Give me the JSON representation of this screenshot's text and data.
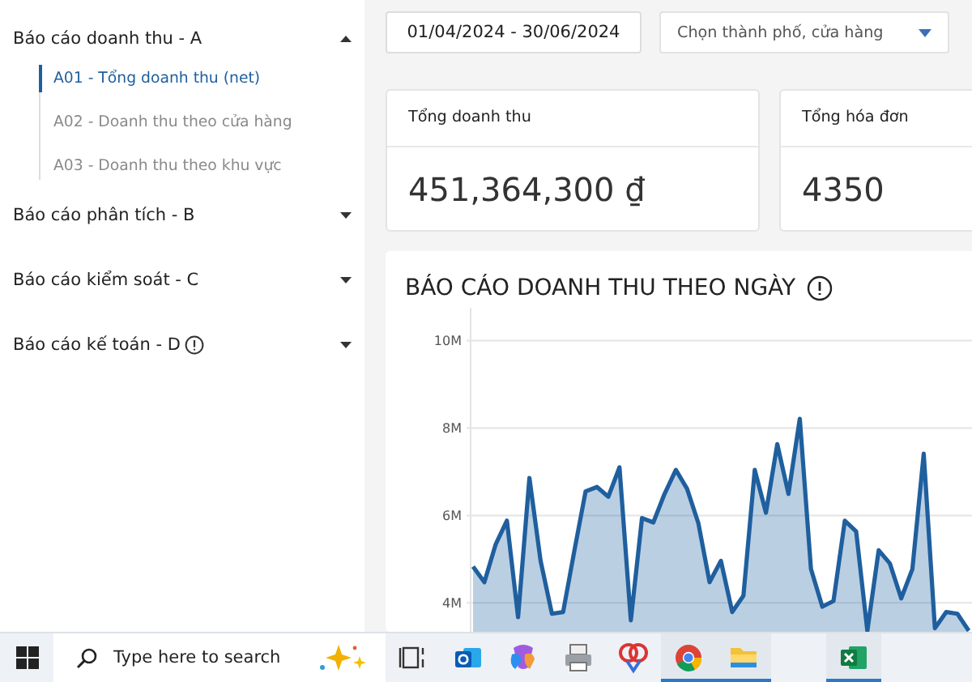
{
  "sidebar": {
    "groups": [
      {
        "label": "Báo cáo doanh thu - A",
        "expanded": true,
        "info": false,
        "items": [
          {
            "label": "A01 - Tổng doanh thu (net)",
            "selected": true
          },
          {
            "label": "A02 - Doanh thu theo cửa hàng",
            "selected": false
          },
          {
            "label": "A03 - Doanh thu theo khu vực",
            "selected": false
          }
        ]
      },
      {
        "label": "Báo cáo phân tích - B",
        "expanded": false,
        "info": false
      },
      {
        "label": "Báo cáo kiểm soát - C",
        "expanded": false,
        "info": false
      },
      {
        "label": "Báo cáo kế toán - D",
        "expanded": false,
        "info": true
      }
    ]
  },
  "filters": {
    "date_range": "01/04/2024 - 30/06/2024",
    "store_select": {
      "placeholder": "Chọn thành phố, cửa hàng"
    }
  },
  "stats": [
    {
      "label": "Tổng doanh thu",
      "value": "451,364,300 ₫"
    },
    {
      "label": "Tổng hóa đơn",
      "value": "4350"
    }
  ],
  "chart_card": {
    "title": "BÁO CÁO DOANH THU THEO NGÀY",
    "chart_data": {
      "type": "area",
      "grid": true,
      "ylim": [
        3.3,
        10.75
      ],
      "yticks": [
        {
          "value": 4,
          "label": "4M"
        },
        {
          "value": 6,
          "label": "6M"
        },
        {
          "value": 8,
          "label": "8M"
        },
        {
          "value": 10,
          "label": "10M"
        }
      ],
      "series": [
        {
          "color": "#1f5f9e",
          "values": [
            4.83,
            4.47,
            5.33,
            5.88,
            3.67,
            6.86,
            4.96,
            3.75,
            3.79,
            5.2,
            6.55,
            6.65,
            6.43,
            7.1,
            3.6,
            5.94,
            5.84,
            6.49,
            7.04,
            6.61,
            5.82,
            4.47,
            4.96,
            3.79,
            4.16,
            7.04,
            6.06,
            7.63,
            6.49,
            8.21,
            4.77,
            3.91,
            4.04,
            5.88,
            5.63,
            3.36,
            5.2,
            4.9,
            4.1,
            4.77,
            7.41,
            3.42,
            3.79,
            3.75,
            3.36
          ]
        }
      ]
    }
  },
  "taskbar": {
    "search": {
      "placeholder": "Type here to search"
    },
    "apps": [
      {
        "kind": "taskview",
        "running": false
      },
      {
        "kind": "outlook",
        "running": false
      },
      {
        "kind": "copilot",
        "running": false
      },
      {
        "kind": "printer",
        "running": false
      },
      {
        "kind": "paint",
        "running": false
      },
      {
        "kind": "chrome",
        "running": true
      },
      {
        "kind": "folder",
        "running": true
      },
      {
        "kind": "excel",
        "running": true
      }
    ]
  }
}
